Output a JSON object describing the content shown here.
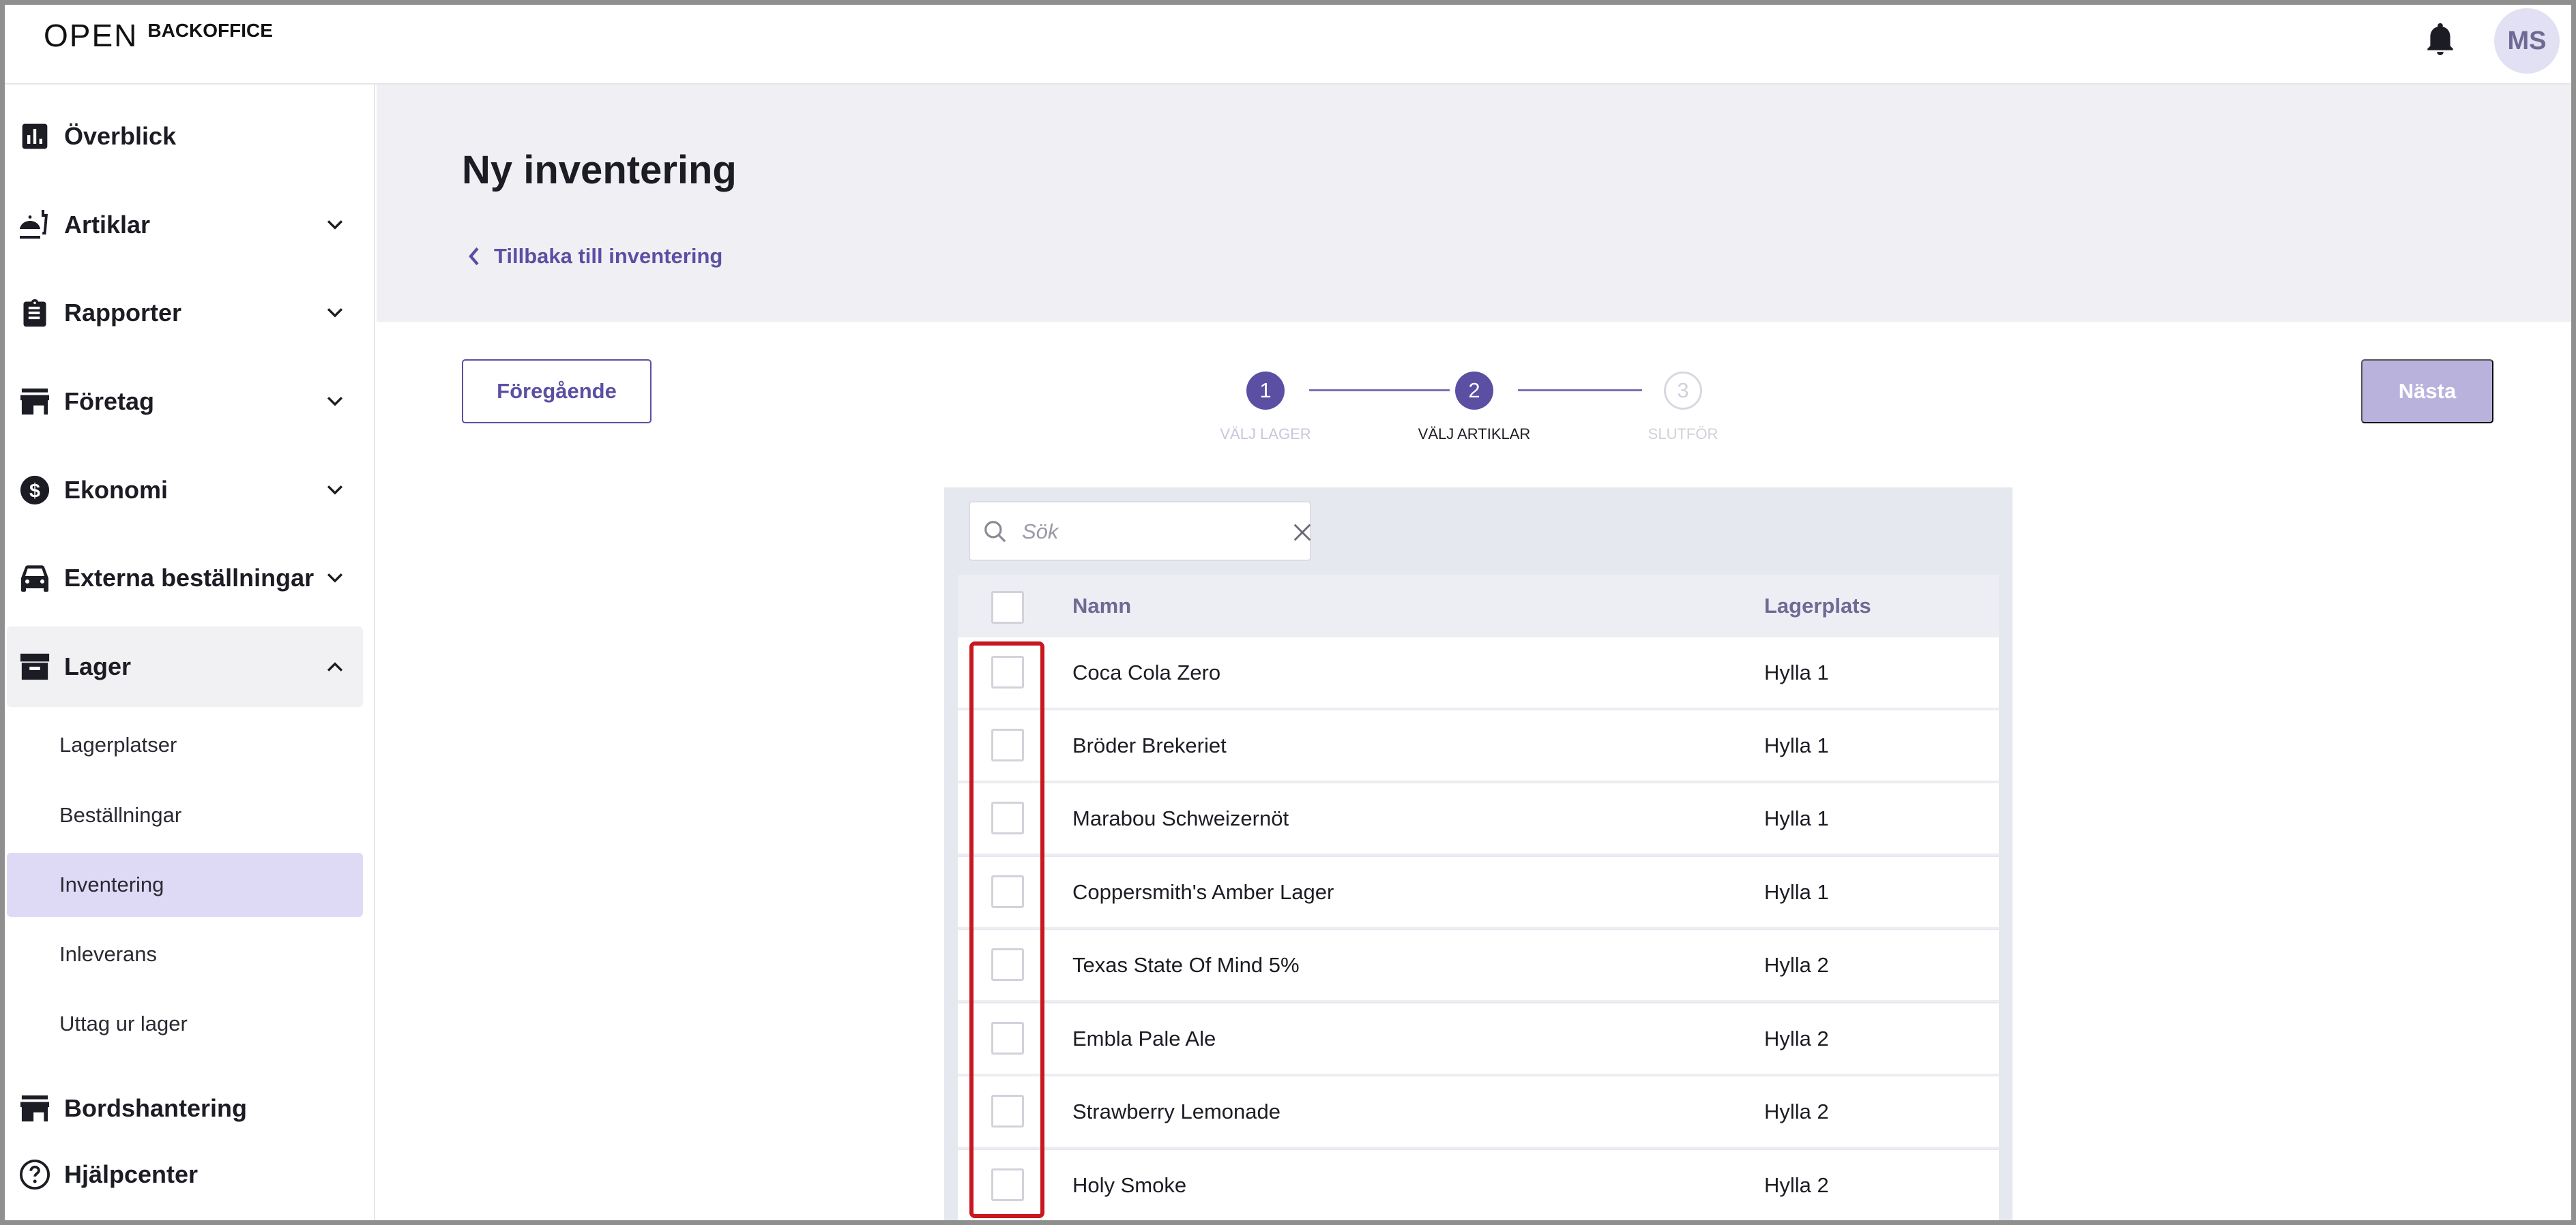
{
  "header": {
    "logo_mark": "OPEN",
    "logo_text": "BACKOFFICE",
    "avatar_initials": "MS"
  },
  "sidebar": {
    "items": [
      {
        "label": "Överblick",
        "icon": "chart-icon",
        "expandable": false
      },
      {
        "label": "Artiklar",
        "icon": "food-icon",
        "expandable": true
      },
      {
        "label": "Rapporter",
        "icon": "clipboard-icon",
        "expandable": true
      },
      {
        "label": "Företag",
        "icon": "store-icon",
        "expandable": true
      },
      {
        "label": "Ekonomi",
        "icon": "dollar-icon",
        "expandable": true
      },
      {
        "label": "Externa beställningar",
        "icon": "car-icon",
        "expandable": true
      },
      {
        "label": "Lager",
        "icon": "archive-icon",
        "expandable": true,
        "expanded": true
      },
      {
        "label": "Bordshantering",
        "icon": "table-icon",
        "expandable": false
      },
      {
        "label": "Hjälpcenter",
        "icon": "help-icon",
        "expandable": false
      }
    ],
    "lager_subitems": [
      {
        "label": "Lagerplatser"
      },
      {
        "label": "Beställningar"
      },
      {
        "label": "Inventering",
        "active": true
      },
      {
        "label": "Inleverans"
      },
      {
        "label": "Uttag ur lager"
      }
    ]
  },
  "page": {
    "title": "Ny inventering",
    "back_link": "Tillbaka till inventering"
  },
  "wizard": {
    "prev_label": "Föregående",
    "next_label": "Nästa",
    "steps": [
      {
        "number": "1",
        "label": "VÄLJ LAGER",
        "state": "done"
      },
      {
        "number": "2",
        "label": "VÄLJ ARTIKLAR",
        "state": "current"
      },
      {
        "number": "3",
        "label": "SLUTFÖR",
        "state": "todo"
      }
    ]
  },
  "search": {
    "placeholder": "Sök",
    "value": ""
  },
  "table": {
    "columns": [
      "Namn",
      "Lagerplats"
    ],
    "rows": [
      {
        "name": "Coca Cola Zero",
        "location": "Hylla 1"
      },
      {
        "name": "Bröder Brekeriet",
        "location": "Hylla 1"
      },
      {
        "name": "Marabou Schweizernöt",
        "location": "Hylla 1"
      },
      {
        "name": "Coppersmith's Amber Lager",
        "location": "Hylla 1"
      },
      {
        "name": "Texas State Of Mind 5%",
        "location": "Hylla 2"
      },
      {
        "name": "Embla Pale Ale",
        "location": "Hylla 2"
      },
      {
        "name": "Strawberry Lemonade",
        "location": "Hylla 2"
      },
      {
        "name": "Holy Smoke",
        "location": "Hylla 2"
      }
    ]
  },
  "colors": {
    "accent": "#5a4fa3",
    "next_disabled": "#b8b2dd",
    "active_sub": "#dedaf6",
    "highlight": "#c8171f"
  }
}
